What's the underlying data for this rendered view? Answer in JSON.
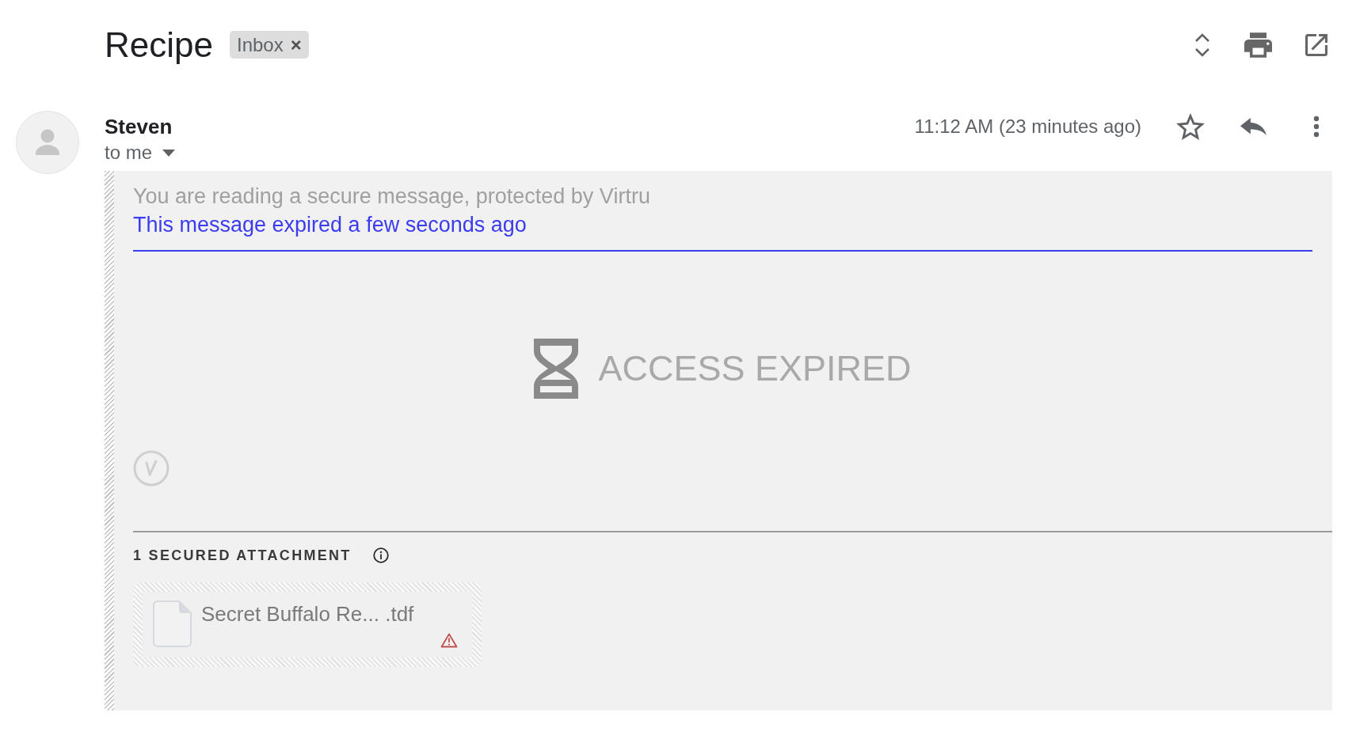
{
  "subject": {
    "title": "Recipe",
    "labels": [
      {
        "text": "Inbox",
        "remove": "×"
      }
    ]
  },
  "message": {
    "sender": "Steven",
    "recipient": "to me",
    "time": "11:12 AM (23 minutes ago)",
    "starred": false
  },
  "secure_message": {
    "notice": "You are reading a secure message, protected by Virtru",
    "expiry": "This message expired a few seconds ago",
    "status": "ACCESS EXPIRED",
    "attachments_heading": "1 SECURED ATTACHMENT",
    "attachments": [
      {
        "name": "Secret Buffalo Re... .tdf",
        "warning": true
      }
    ]
  }
}
